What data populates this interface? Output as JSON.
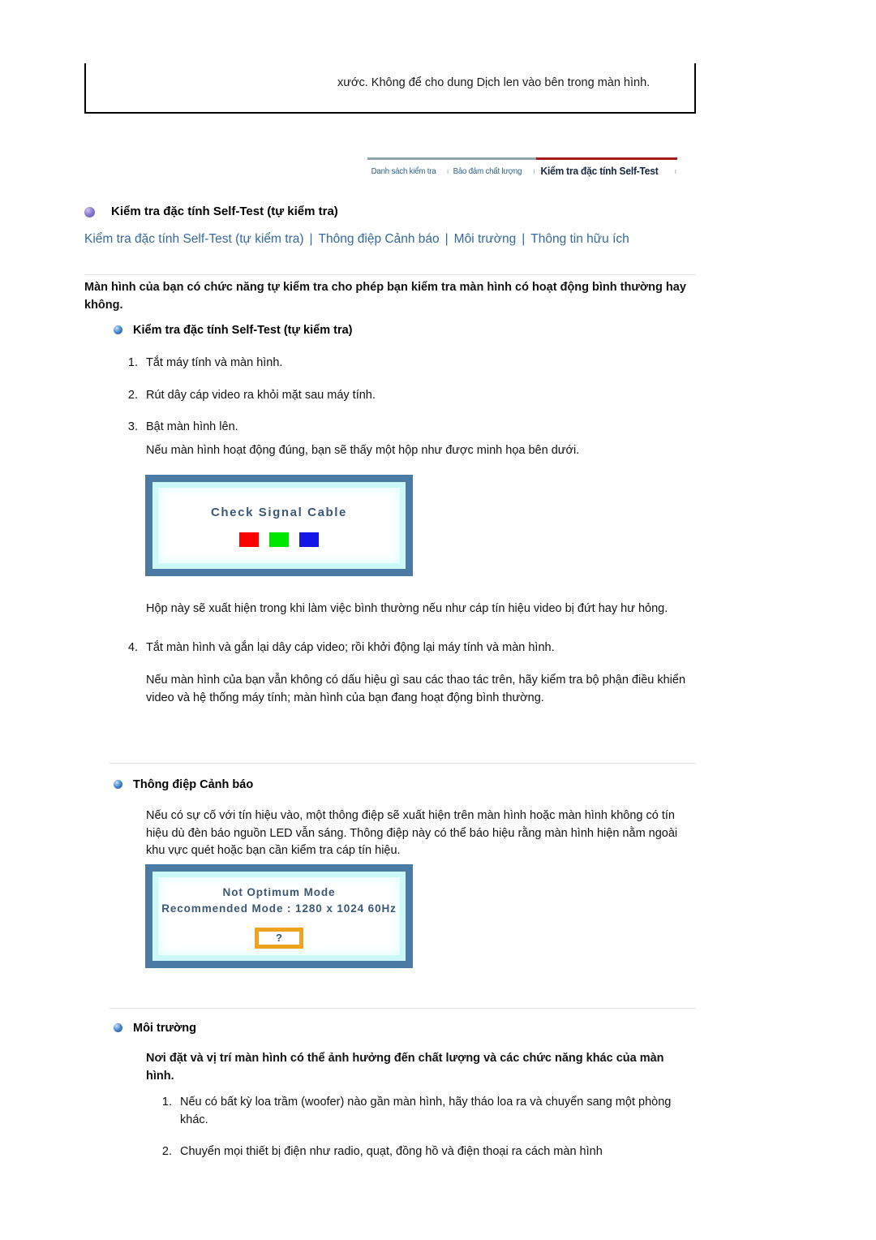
{
  "top_note": {
    "text": "xước. Không để cho dung Dịch len vào bên trong màn hình."
  },
  "navbar": {
    "items": [
      {
        "label": "Danh sách kiểm tra",
        "active": false
      },
      {
        "label": "Bảo đảm chất lượng",
        "active": false
      },
      {
        "label": "Kiểm tra đặc tính Self-Test",
        "active": true
      }
    ],
    "separator": "ı",
    "inactive_border_color": "#8fa7ab",
    "active_border_color": "#a71a20",
    "inactive_text_color": "#2d5f8a",
    "active_text_color": "#16253c"
  },
  "page_heading": {
    "title": "Kiểm tra đặc tính Self-Test (tự kiểm tra)",
    "bullet_icon": "purple-sphere-bullet-icon"
  },
  "quick_links": {
    "items": [
      "Kiểm tra đặc tính Self-Test (tự kiểm tra)",
      "Thông điệp Cảnh báo",
      "Môi trường",
      "Thông tin hữu ích"
    ],
    "separator": "|",
    "color": "#36699e"
  },
  "intro": {
    "text": "Màn hình của bạn có chức năng tự kiểm tra cho phép bạn kiểm tra màn hình có hoạt động bình thường hay không."
  },
  "self_test": {
    "heading": "Kiểm tra đặc tính Self-Test (tự kiểm tra)",
    "bullet_icon": "blue-sphere-bullet-icon",
    "steps": [
      {
        "num": "1.",
        "text": "Tắt máy tính và màn hình."
      },
      {
        "num": "2.",
        "text": "Rút dây cáp video ra khỏi mặt sau máy tính."
      },
      {
        "num": "3.",
        "text": "Bật màn hình lên."
      }
    ],
    "after_step3": "Nếu màn hình hoạt động đúng, bạn sẽ thấy một hộp như được minh họa bên dưới.",
    "osd": {
      "title": "Check Signal Cable",
      "swatches": [
        "#fe0000",
        "#00e800",
        "#1616e8"
      ],
      "frame_color": "#4b7ba4",
      "glow_color": "#ccf8f8"
    },
    "after_osd": "Hộp này sẽ xuất hiện trong khi làm việc bình thường nếu như cáp tín hiệu video bị đứt hay hư hỏng.",
    "step4": {
      "num": "4.",
      "text": "Tắt màn hình và gắn lại dây cáp video; rồi khởi động lại máy tính và màn hình."
    },
    "closing": "Nếu màn hình của bạn vẫn không có dấu hiệu gì sau các thao tác trên, hãy kiểm tra bộ phận điều khiển video và hệ thống máy tính; màn hình của bạn đang hoạt động bình thường."
  },
  "warning_message": {
    "heading": "Thông điệp Cảnh báo",
    "bullet_icon": "blue-sphere-bullet-icon",
    "body": "Nếu có sự cố với tín hiệu vào, một thông điệp sẽ xuất hiện trên màn hình hoặc màn hình không có tín hiệu dù đèn báo nguồn LED vẫn sáng. Thông điệp này có thể báo hiệu rằng màn hình hiện nằm ngoài khu vực quét hoặc bạn cần kiểm tra cáp tín hiệu.",
    "osd": {
      "line1": "Not Optimum Mode",
      "line2": "Recommended Mode : 1280 x 1024  60Hz",
      "button_label": "?",
      "button_border_color": "#f0a31e",
      "frame_color": "#4b7ba4"
    }
  },
  "environment": {
    "heading": "Môi trường",
    "bullet_icon": "blue-sphere-bullet-icon",
    "lead": "Nơi đặt và vị trí màn hình có thể ảnh hưởng đến chất lượng và các chức năng khác của màn hình.",
    "items": [
      {
        "num": "1.",
        "text": "Nếu có bất kỳ loa trầm (woofer) nào gần màn hình, hãy tháo loa ra và chuyển sang một phòng khác."
      },
      {
        "num": "2.",
        "text": "Chuyển mọi thiết bị điện như radio, quạt, đồng hồ và điện thoại ra cách màn hình"
      }
    ]
  }
}
